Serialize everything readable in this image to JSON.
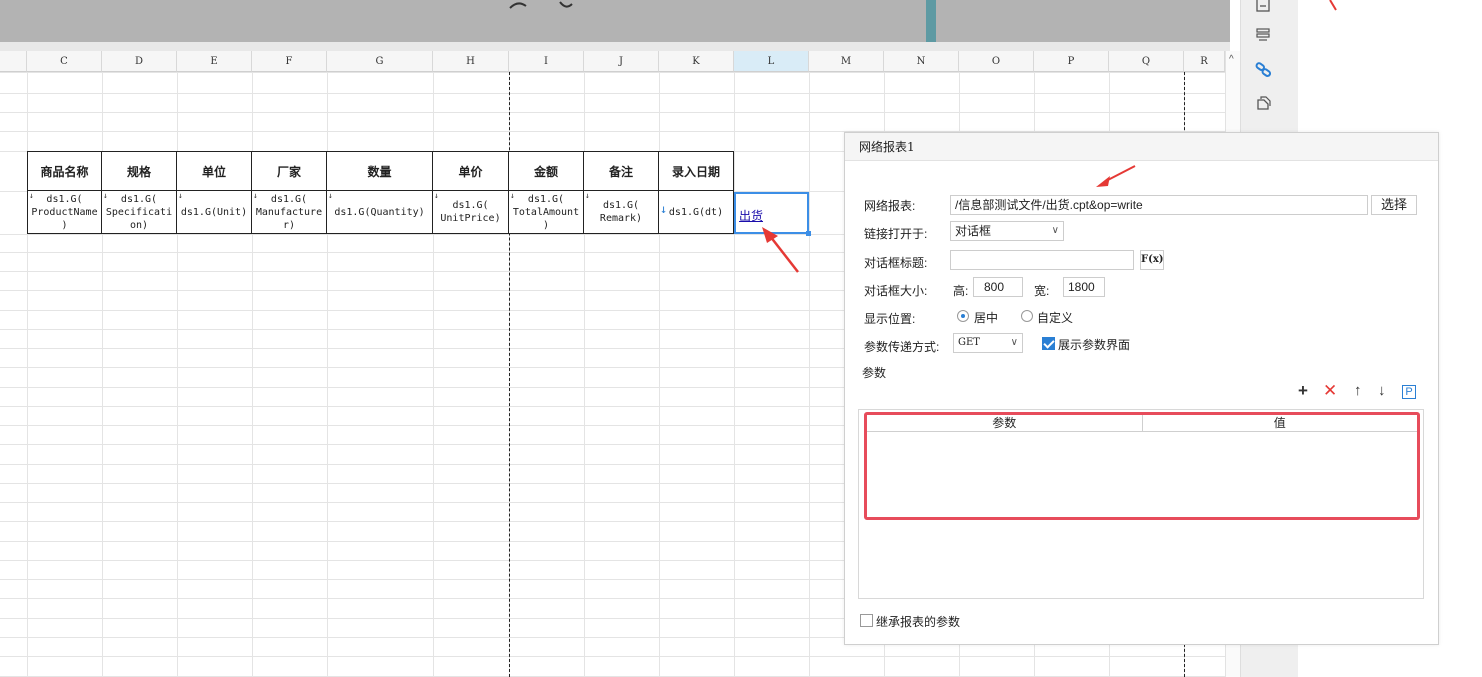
{
  "columns": [
    "C",
    "D",
    "E",
    "F",
    "G",
    "H",
    "I",
    "J",
    "K",
    "L",
    "M",
    "N",
    "O",
    "P",
    "Q",
    "R"
  ],
  "selected_column": "L",
  "table": {
    "headers": [
      "商品名称",
      "规格",
      "单位",
      "厂家",
      "数量",
      "单价",
      "金额",
      "备注",
      "录入日期"
    ],
    "cells": [
      {
        "line1": "ds1.G(",
        "line2": "ProductName",
        "line3": ")"
      },
      {
        "line1": "ds1.G(",
        "line2": "Specificati",
        "line3": "on)"
      },
      {
        "line1": "ds1.G(Unit)",
        "line2": "",
        "line3": ""
      },
      {
        "line1": "ds1.G(",
        "line2": "Manufacture",
        "line3": "r)"
      },
      {
        "line1": "ds1.G(Quantity)",
        "line2": "",
        "line3": ""
      },
      {
        "line1": "ds1.G(",
        "line2": "UnitPrice)",
        "line3": ""
      },
      {
        "line1": "ds1.G(",
        "line2": "TotalAmount",
        "line3": ")"
      },
      {
        "line1": "ds1.G(",
        "line2": "Remark)",
        "line3": ""
      },
      {
        "line1": "ds1.G(dt)",
        "line2": "",
        "line3": ""
      }
    ],
    "link_text": "出货"
  },
  "panel": {
    "title": "网络报表1",
    "report_label": "网络报表:",
    "report_value": "/信息部测试文件/出货.cpt&op=write",
    "choose_button": "选择",
    "open_in_label": "链接打开于:",
    "open_in_value": "对话框",
    "dialog_title_label": "对话框标题:",
    "dialog_title_value": "",
    "formula_button": "F(x)",
    "dialog_size_label": "对话框大小:",
    "height_label": "高:",
    "height_value": "800",
    "width_label": "宽:",
    "width_value": "1800",
    "position_label": "显示位置:",
    "position_center": "居中",
    "position_custom": "自定义",
    "method_label": "参数传递方式:",
    "method_value": "GET",
    "show_params_label": "展示参数界面",
    "params_section": "参数",
    "param_col_name": "参数",
    "param_col_value": "值",
    "inherit_label": "继承报表的参数"
  },
  "icons": [
    "add-icon",
    "delete-icon",
    "move-up-icon",
    "move-down-icon",
    "parameter-icon"
  ],
  "colors": {
    "accent": "#2a7fd4",
    "highlight_border": "#e74c5b",
    "annotation_arrow": "#e53935"
  }
}
